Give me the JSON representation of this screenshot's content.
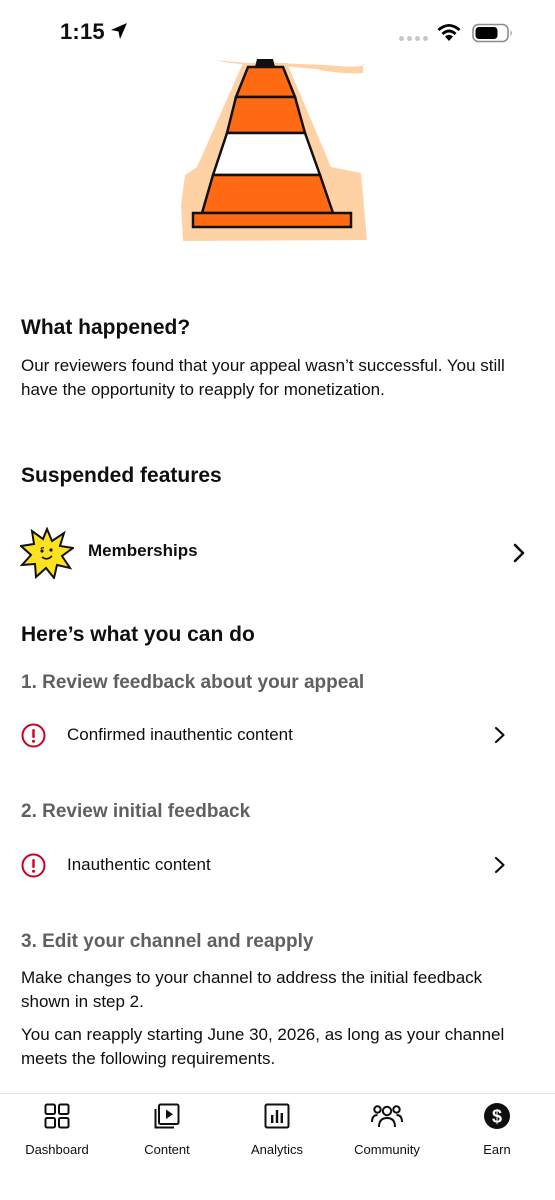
{
  "status": {
    "time": "1:15"
  },
  "what_happened": {
    "title": "What happened?",
    "body": "Our reviewers found that your appeal wasn’t successful. You still have the opportunity to reapply for monetization."
  },
  "suspended": {
    "title": "Suspended features",
    "items": [
      {
        "label": "Memberships",
        "icon": "star-mascot-icon"
      }
    ]
  },
  "actions": {
    "title": "Here’s what you can do",
    "step1": {
      "title": "1. Review feedback about your appeal",
      "item": "Confirmed inauthentic content"
    },
    "step2": {
      "title": "2. Review initial feedback",
      "item": "Inauthentic content"
    },
    "step3": {
      "title": "3. Edit your channel and reapply",
      "p1": "Make changes to your channel to address the initial feedback shown in step 2.",
      "p2": "You can reapply starting June 30, 2026, as long as your channel meets the following requirements."
    }
  },
  "nav": {
    "items": [
      {
        "label": "Dashboard",
        "icon": "dashboard-icon"
      },
      {
        "label": "Content",
        "icon": "content-icon"
      },
      {
        "label": "Analytics",
        "icon": "analytics-icon"
      },
      {
        "label": "Community",
        "icon": "community-icon"
      },
      {
        "label": "Earn",
        "icon": "earn-icon"
      }
    ]
  },
  "colors": {
    "alert": "#cc0022",
    "secondary_text": "#606060",
    "cone_orange": "#ff6a13",
    "star_yellow": "#ffe21f"
  }
}
